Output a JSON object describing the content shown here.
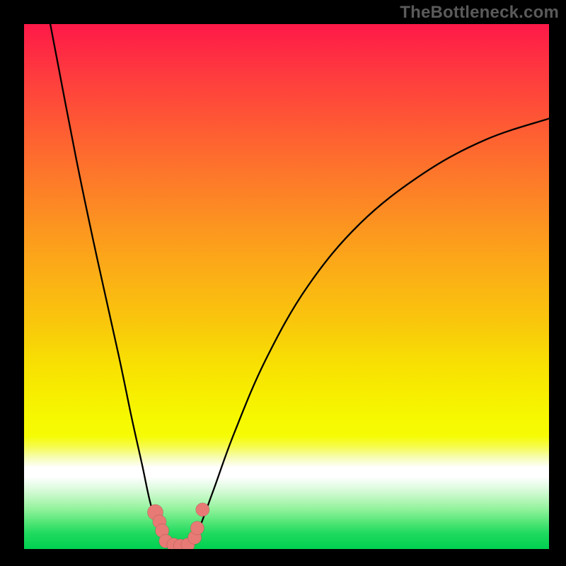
{
  "watermark": "TheBottleneck.com",
  "colors": {
    "frame": "#000000",
    "gradient": {
      "top": "#FE1948",
      "band10": "#FE3C3E",
      "band20": "#FE5C33",
      "band30": "#FD7B29",
      "band40": "#FC991E",
      "band50": "#FBB513",
      "band55": "#F9C70C",
      "band62": "#F8DE03",
      "band67": "#F7ED00",
      "band72": "#F6F800",
      "band76": "#F6FC05",
      "band_yellow_soft": "#F6FC4D",
      "band_yellow_pale": "#F6FCB0",
      "band_white": "#FFFFFF",
      "band_mint_pale": "#DDFBDE",
      "band_mint_light": "#B8F7BB",
      "band_mint_mid": "#8FF29A",
      "band_mint": "#5CE87C",
      "band_green": "#1FDA5E",
      "bottom": "#00D050"
    },
    "curve": "#000000",
    "marker_fill": "#E77A75",
    "marker_stroke": "rgba(0,0,0,0.25)"
  },
  "chart_data": {
    "type": "line",
    "title": "",
    "xlabel": "",
    "ylabel": "",
    "xlim": [
      0,
      100
    ],
    "ylim": [
      0,
      100
    ],
    "grid": false,
    "legend": false,
    "curve_left": {
      "description": "left falling branch of V-shape",
      "points": [
        {
          "x": 5.0,
          "y": 100.0
        },
        {
          "x": 10.0,
          "y": 74.0
        },
        {
          "x": 14.0,
          "y": 55.0
        },
        {
          "x": 18.0,
          "y": 37.0
        },
        {
          "x": 20.5,
          "y": 25.0
        },
        {
          "x": 22.5,
          "y": 16.0
        },
        {
          "x": 24.0,
          "y": 9.0
        },
        {
          "x": 25.5,
          "y": 4.0
        },
        {
          "x": 27.0,
          "y": 1.5
        },
        {
          "x": 28.5,
          "y": 0.5
        }
      ]
    },
    "curve_right": {
      "description": "right rising branch of V-shape (concave, saturating)",
      "points": [
        {
          "x": 31.5,
          "y": 0.5
        },
        {
          "x": 33.0,
          "y": 3.0
        },
        {
          "x": 36.0,
          "y": 11.0
        },
        {
          "x": 40.0,
          "y": 22.0
        },
        {
          "x": 46.0,
          "y": 36.0
        },
        {
          "x": 54.0,
          "y": 50.0
        },
        {
          "x": 64.0,
          "y": 62.0
        },
        {
          "x": 76.0,
          "y": 71.5
        },
        {
          "x": 88.0,
          "y": 78.0
        },
        {
          "x": 100.0,
          "y": 82.0
        }
      ]
    },
    "floor_segment": {
      "x0": 28.5,
      "x1": 31.5,
      "y": 0.5
    },
    "markers": [
      {
        "x": 25.0,
        "y": 7.0,
        "r": 1.5
      },
      {
        "x": 25.8,
        "y": 5.2,
        "r": 1.3
      },
      {
        "x": 26.3,
        "y": 3.5,
        "r": 1.3
      },
      {
        "x": 27.0,
        "y": 1.5,
        "r": 1.3
      },
      {
        "x": 28.5,
        "y": 0.8,
        "r": 1.3
      },
      {
        "x": 29.8,
        "y": 0.6,
        "r": 1.3
      },
      {
        "x": 31.2,
        "y": 0.8,
        "r": 1.3
      },
      {
        "x": 32.5,
        "y": 2.2,
        "r": 1.3
      },
      {
        "x": 33.0,
        "y": 4.0,
        "r": 1.3
      },
      {
        "x": 34.0,
        "y": 7.5,
        "r": 1.3
      }
    ]
  }
}
